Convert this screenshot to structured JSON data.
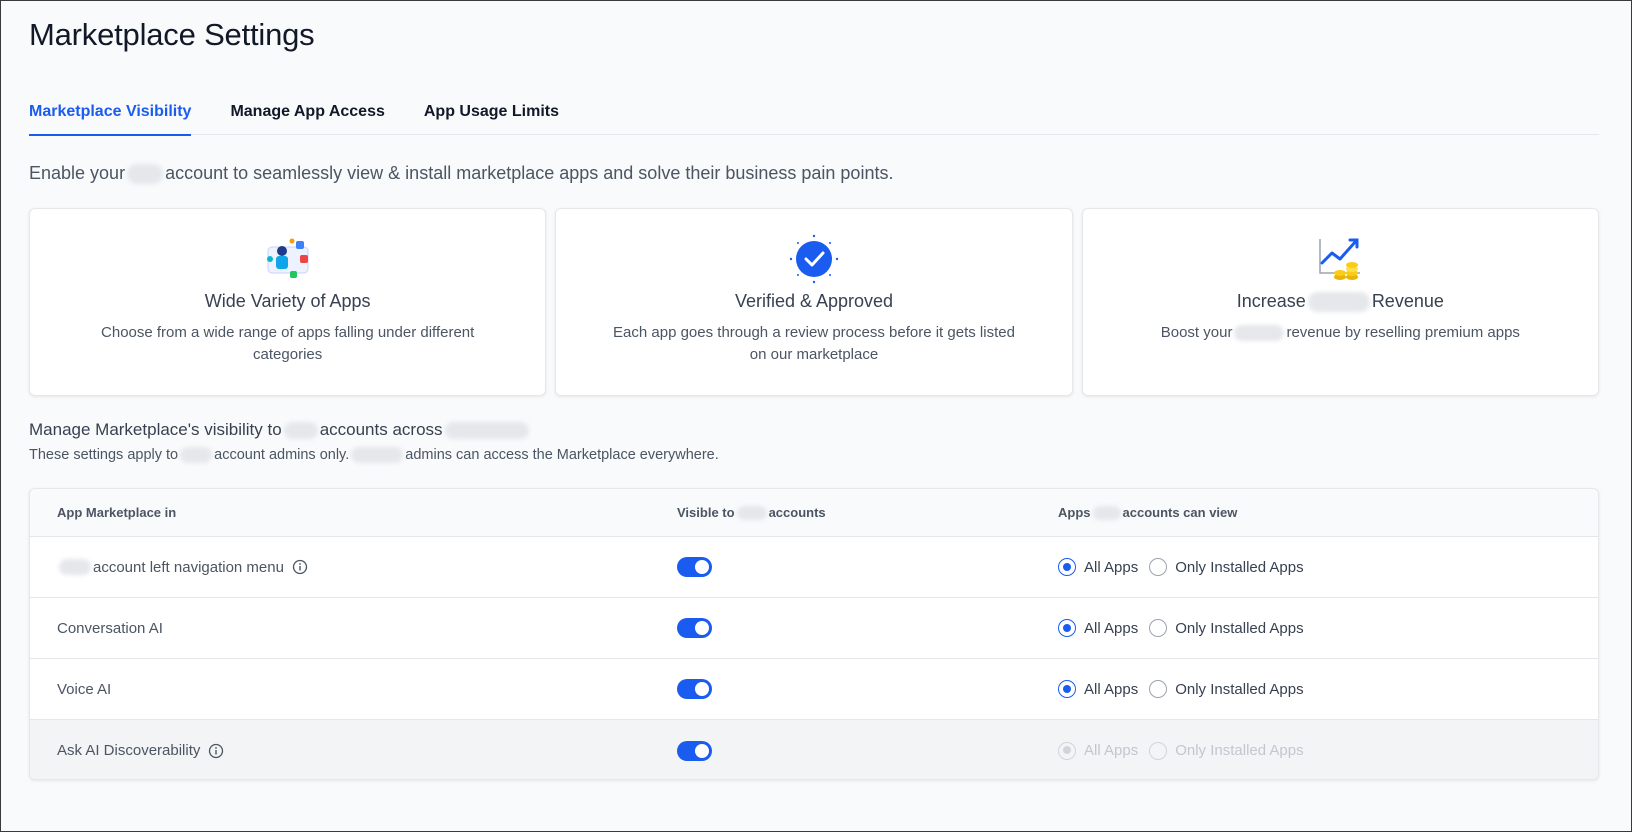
{
  "page_title": "Marketplace Settings",
  "tabs": [
    {
      "label": "Marketplace Visibility",
      "active": true
    },
    {
      "label": "Manage App Access",
      "active": false
    },
    {
      "label": "App Usage Limits",
      "active": false
    }
  ],
  "intro": {
    "before": "Enable your",
    "after": "account to seamlessly view & install marketplace apps and solve their business pain points."
  },
  "cards": [
    {
      "icon": "apps-variety-illustration-icon",
      "title": "Wide Variety of Apps",
      "title_suffix": "",
      "desc_before": "Choose from a wide range of apps falling under different categories",
      "desc_after": ""
    },
    {
      "icon": "verified-badge-icon",
      "title": "Verified & Approved",
      "title_suffix": "",
      "desc_before": "Each app goes through a review process before it gets listed on our marketplace",
      "desc_after": ""
    },
    {
      "icon": "revenue-growth-icon",
      "title": "Increase",
      "title_suffix": "Revenue",
      "desc_before": "Boost your",
      "desc_after": "revenue by reselling premium apps"
    }
  ],
  "section": {
    "title_before": "Manage Marketplace's visibility to",
    "title_middle": "accounts across",
    "sub_before": "These settings apply to",
    "sub_middle": "account admins only.",
    "sub_after": "admins can access the Marketplace everywhere."
  },
  "table": {
    "headers": {
      "col1": "App Marketplace in",
      "col2_before": "Visible to",
      "col2_after": "accounts",
      "col3_before": "Apps",
      "col3_after": "accounts can view"
    },
    "rows": [
      {
        "label": "account left navigation menu",
        "blurred_prefix": true,
        "info": true,
        "visible": true,
        "selected": "All Apps",
        "disabled": false
      },
      {
        "label": "Conversation AI",
        "blurred_prefix": false,
        "info": false,
        "visible": true,
        "selected": "All Apps",
        "disabled": false
      },
      {
        "label": "Voice AI",
        "blurred_prefix": false,
        "info": false,
        "visible": true,
        "selected": "All Apps",
        "disabled": false
      },
      {
        "label": "Ask AI Discoverability",
        "blurred_prefix": false,
        "info": true,
        "visible": true,
        "selected": "All Apps",
        "disabled": true
      }
    ],
    "radio_options": [
      "All Apps",
      "Only Installed Apps"
    ]
  },
  "colors": {
    "accent": "#1a5cf0",
    "text": "#111827",
    "muted": "#4b5563",
    "border": "#e5e7eb"
  }
}
